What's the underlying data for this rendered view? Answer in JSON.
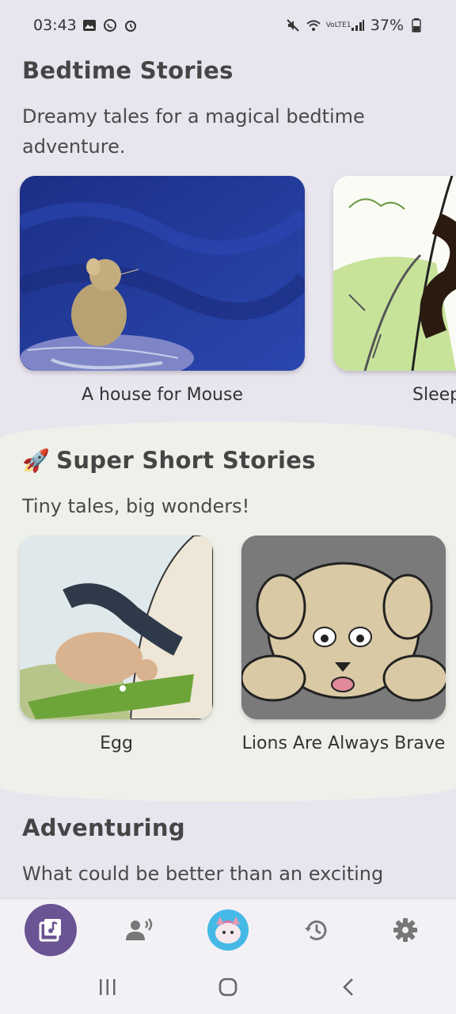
{
  "status_bar": {
    "time": "03:43",
    "battery": "37%",
    "network": "VoLTE1"
  },
  "sections": [
    {
      "title": "Bedtime Stories",
      "subtitle": "Dreamy tales for a magical bedtime adventure.",
      "cards": [
        {
          "title": "A house for Mouse",
          "image": "mouse-illustration"
        },
        {
          "title": "Sleep",
          "image": "tree-snake-illustration"
        }
      ]
    },
    {
      "title_icon": "🚀",
      "title": "Super Short Stories",
      "subtitle": "Tiny tales, big wonders!",
      "cards": [
        {
          "title": "Egg",
          "image": "birds-crocodile-illustration"
        },
        {
          "title": "Lions Are Always Brave",
          "image": "lion-cub-illustration"
        }
      ]
    },
    {
      "title": "Adventuring",
      "subtitle": "What could be better than an exciting"
    }
  ],
  "bottom_nav": {
    "items": [
      "library",
      "voice",
      "avatar",
      "history",
      "settings"
    ],
    "active": "library",
    "active_color": "#6b5494"
  },
  "colors": {
    "background": "#e8e5ef",
    "band": "#eef0ea",
    "title": "#454545"
  }
}
